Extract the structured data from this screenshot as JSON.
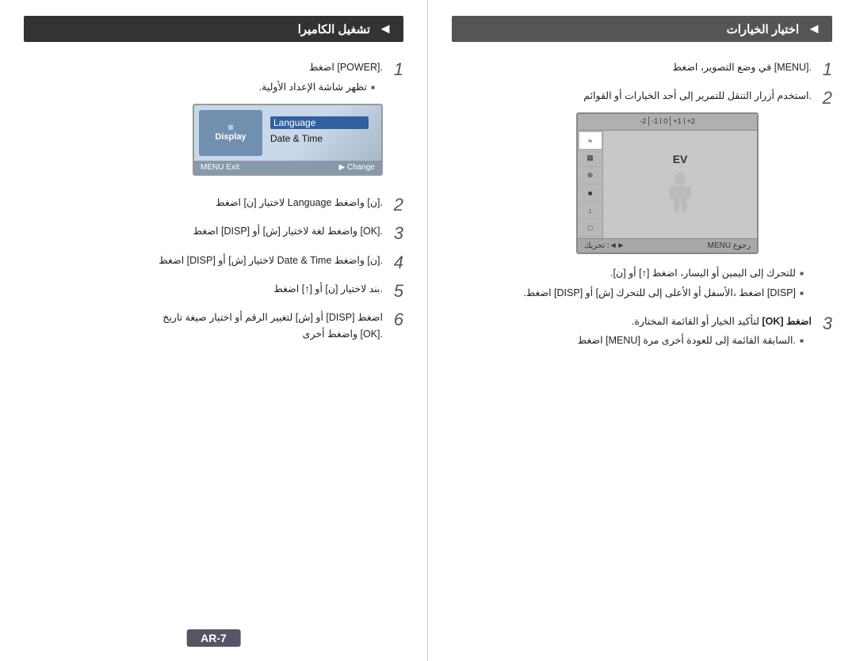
{
  "right_column": {
    "header": "تشغيل الكاميرا",
    "header_arrow": "◄",
    "step1": {
      "num": "1",
      "text": ".[POWER] اضغط",
      "bullet": "تظهر شاشة الإعداد الأولية."
    },
    "display_screen": {
      "left_label": "Display",
      "left_icon": "▦",
      "items": [
        "Language",
        "Date & Time"
      ],
      "selected": 0,
      "footer_left": "MENU Exit",
      "footer_right": "▶ Change"
    },
    "step2": {
      "num": "2",
      "text": ".[ن] واضغط Language لاختيار [ن] اضغط"
    },
    "step3": {
      "num": "3",
      "text": ".[OK] واضغط لغة لاختيار [ش] أو [DISP] اضغط"
    },
    "step4": {
      "num": "4",
      "text": ".[ن] واضغط Date & Time لاختيار [ش] أو [DISP] اضغط"
    },
    "step5": {
      "num": "5",
      "text": ".بند لاختيار [ن] أو [↑] اضغط"
    },
    "step6": {
      "num": "6",
      "text": "اضغط [DISP] أو [ش] لتغيير الرقم أو اختيار صيغة تاريخ\n.[OK] واضغط أخرى"
    }
  },
  "left_column": {
    "header": "اختيار الخيارات",
    "header_arrow": "◄",
    "step1": {
      "num": "1",
      "text": ".[MENU] في وضع التصوير، اضغط"
    },
    "step2": {
      "num": "2",
      "text": ".استخدم أزرار التنقل للتمرير إلى أحد الخيارات أو القوائم"
    },
    "camera_menu": {
      "ev_labels": [
        "-2",
        "-1",
        "0",
        "+1",
        "+2"
      ],
      "ev_label": "EV",
      "icons": [
        "≈",
        "▦",
        "⊕",
        "■",
        "↕",
        "□"
      ],
      "selected_icon": 0,
      "footer_left": "MENU رجوع",
      "footer_right": "تحريك :◄►"
    },
    "bullets_step2": [
      "للتحرك إلى اليمين أو اليسار، اضغط [↑] أو [ن].",
      "[DISP] اضغط ،الأسفل أو الأعلى إلى للتحرك [ش] أو [DISP] اضغط."
    ],
    "step3": {
      "num": "3",
      "text": ".المختارة القائمة أو الخيار لتأكيد [OK] اضغط",
      "bullet": ".السابقة القائمة إلى للعودة أخرى مرة [MENU] اضغط"
    }
  },
  "page_number": "AR-7"
}
